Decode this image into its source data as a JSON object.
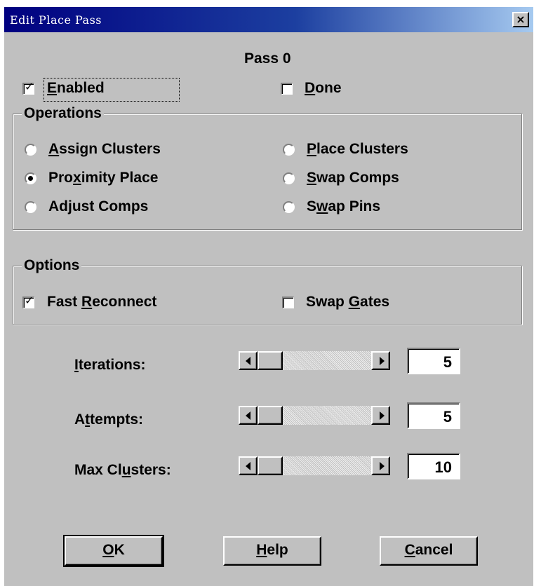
{
  "window": {
    "title": "Edit Place Pass",
    "close_icon": "×"
  },
  "header": {
    "pass_label": "Pass 0"
  },
  "enabled": {
    "label_u": "E",
    "label_rest": "nabled",
    "checked": true
  },
  "done": {
    "label_u": "D",
    "label_rest": "one",
    "checked": false
  },
  "operations": {
    "title": "Operations",
    "selected": "Proximity Place",
    "items": [
      {
        "pre": "",
        "u": "A",
        "post": "ssign Clusters"
      },
      {
        "pre": "",
        "u": "P",
        "post": "lace Clusters"
      },
      {
        "pre": "Pro",
        "u": "x",
        "post": "imity Place"
      },
      {
        "pre": "",
        "u": "S",
        "post": "wap Comps"
      },
      {
        "pre": "Adjust Comps",
        "u": "",
        "post": ""
      },
      {
        "pre": "S",
        "u": "w",
        "post": "ap Pins"
      }
    ]
  },
  "options": {
    "title": "Options",
    "fast_reconnect": {
      "pre": "Fast ",
      "u": "R",
      "post": "econnect",
      "checked": true
    },
    "swap_gates": {
      "pre": "Swap ",
      "u": "G",
      "post": "ates",
      "checked": false
    }
  },
  "params": {
    "iterations": {
      "pre": "",
      "u": "I",
      "post": "terations:",
      "value": "5"
    },
    "attempts": {
      "pre": "A",
      "u": "t",
      "post": "tempts:",
      "value": "5"
    },
    "max_clusters": {
      "pre": "Max Cl",
      "u": "u",
      "post": "sters:",
      "value": "10"
    }
  },
  "buttons": {
    "ok": {
      "u": "O",
      "post": "K"
    },
    "help": {
      "u": "H",
      "post": "elp"
    },
    "cancel": {
      "u": "C",
      "post": "ancel"
    }
  }
}
